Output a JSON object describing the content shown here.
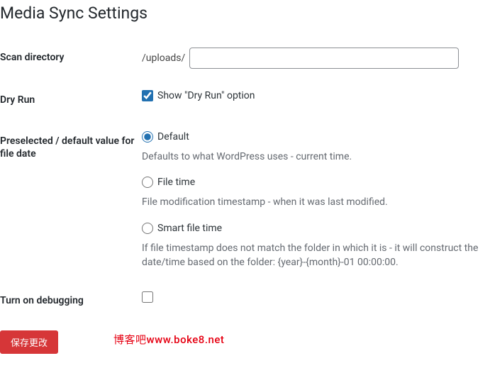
{
  "title": "Media Sync Settings",
  "fields": {
    "scan_directory": {
      "label": "Scan directory",
      "prefix": "/uploads/",
      "value": ""
    },
    "dry_run": {
      "label": "Dry Run",
      "checkbox_label": "Show \"Dry Run\" option",
      "checked": true
    },
    "file_date": {
      "label": "Preselected / default value for file date",
      "options": [
        {
          "label": "Default",
          "description": "Defaults to what WordPress uses - current time.",
          "selected": true
        },
        {
          "label": "File time",
          "description": "File modification timestamp - when it was last modified.",
          "selected": false
        },
        {
          "label": "Smart file time",
          "description": "If file timestamp does not match the folder in which it is - it will construct the date/time based on the folder: {year}-{month}-01 00:00:00.",
          "selected": false
        }
      ]
    },
    "debugging": {
      "label": "Turn on debugging",
      "checked": false
    }
  },
  "submit_label": "保存更改",
  "watermark": "博客吧www.boke8.net"
}
